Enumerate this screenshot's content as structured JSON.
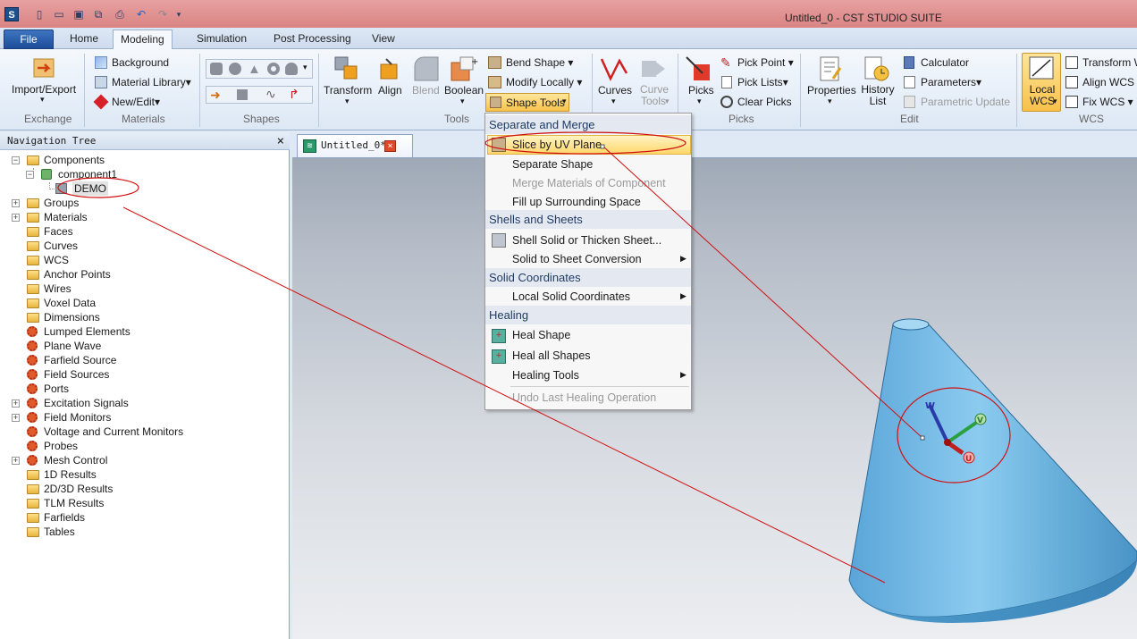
{
  "window": {
    "title": "Untitled_0 - CST STUDIO SUITE",
    "app_icon_letter": "S"
  },
  "tabs": [
    "File",
    "Home",
    "Modeling",
    "Simulation",
    "Post Processing",
    "View"
  ],
  "ribbon": {
    "exchange": {
      "import_export": "Import/Export",
      "group": "Exchange"
    },
    "materials": {
      "background": "Background",
      "material_library": "Material Library",
      "new_edit": "New/Edit",
      "group": "Materials"
    },
    "shapes": {
      "group": "Shapes"
    },
    "tools": {
      "transform": "Transform",
      "align": "Align",
      "blend": "Blend",
      "boolean": "Boolean",
      "bend_shape": "Bend Shape",
      "modify_locally": "Modify Locally",
      "shape_tools": "Shape Tools",
      "group": "Tools"
    },
    "curves": {
      "curves": "Curves",
      "curve_tools": "Curve Tools"
    },
    "picks": {
      "picks": "Picks",
      "pick_point": "Pick Point",
      "pick_lists": "Pick Lists",
      "clear_picks": "Clear Picks",
      "group": "Picks"
    },
    "edit": {
      "properties": "Properties",
      "history_list": "History List",
      "calculator": "Calculator",
      "parameters": "Parameters",
      "parametric_update": "Parametric Update",
      "group": "Edit"
    },
    "wcs": {
      "local_wcs": "Local WCS",
      "transform_wcs": "Transform WCS",
      "align_wcs": "Align WCS",
      "fix_wcs": "Fix WCS",
      "group": "WCS"
    }
  },
  "nav": {
    "title": "Navigation Tree",
    "close": "×",
    "items": [
      "Components",
      "component1",
      "DEMO",
      "Groups",
      "Materials",
      "Faces",
      "Curves",
      "WCS",
      "Anchor Points",
      "Wires",
      "Voxel Data",
      "Dimensions",
      "Lumped Elements",
      "Plane Wave",
      "Farfield Source",
      "Field Sources",
      "Ports",
      "Excitation Signals",
      "Field Monitors",
      "Voltage and Current Monitors",
      "Probes",
      "Mesh Control",
      "1D Results",
      "2D/3D Results",
      "TLM Results",
      "Farfields",
      "Tables"
    ]
  },
  "doc_tab": {
    "label": "Untitled_0*"
  },
  "menu": {
    "headers": [
      "Separate and Merge",
      "Shells and Sheets",
      "Solid Coordinates",
      "Healing"
    ],
    "items": [
      "Slice by UV Plane",
      "Separate Shape",
      "Merge Materials of Component",
      "Fill up Surrounding Space",
      "Shell Solid or Thicken Sheet...",
      "Solid to Sheet Conversion",
      "Local Solid Coordinates",
      "Heal Shape",
      "Heal all Shapes",
      "Healing Tools",
      "Undo Last Healing Operation"
    ]
  },
  "axes": {
    "w": "W",
    "v": "V",
    "u": "U"
  },
  "colors": {
    "titlebar": "#d98484",
    "annotation": "#d01010",
    "cone": "#6ab2dc",
    "menu_highlight": "#ffd86b"
  }
}
